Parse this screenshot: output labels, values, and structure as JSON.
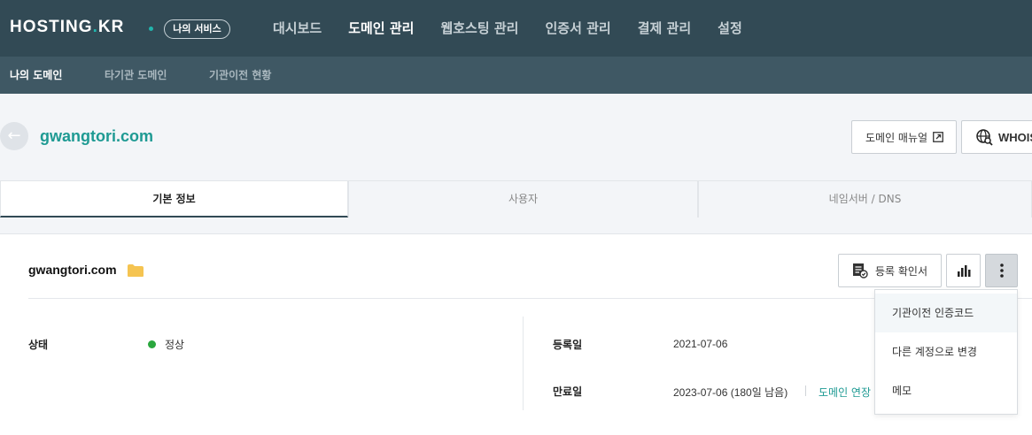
{
  "topbar": {
    "logo_main": "HOSTING",
    "logo_dot": ".",
    "logo_tld": "KR",
    "my_service": "나의 서비스",
    "nav": [
      {
        "label": "대시보드",
        "active": false
      },
      {
        "label": "도메인 관리",
        "active": true
      },
      {
        "label": "웹호스팅 관리",
        "active": false
      },
      {
        "label": "인증서 관리",
        "active": false
      },
      {
        "label": "결제 관리",
        "active": false
      },
      {
        "label": "설정",
        "active": false
      }
    ]
  },
  "subnav": {
    "items": [
      {
        "label": "나의 도메인",
        "active": true
      },
      {
        "label": "타기관 도메인",
        "active": false
      },
      {
        "label": "기관이전 현황",
        "active": false
      }
    ]
  },
  "header": {
    "domain": "gwangtori.com",
    "manual_button": "도메인 매뉴얼",
    "whois_button": "WHOIS"
  },
  "tabs": [
    {
      "label": "기본 정보",
      "active": true
    },
    {
      "label": "사용자",
      "active": false
    },
    {
      "label": "네임서버 / DNS",
      "active": false
    }
  ],
  "card": {
    "title": "gwangtori.com",
    "cert_button": "등록 확인서",
    "status_label": "상태",
    "status_value": "정상",
    "status_color": "#2aa73e",
    "registered_label": "등록일",
    "registered_value": "2021-07-06",
    "expiry_label": "만료일",
    "expiry_value": "2023-07-06 (180일 남음)",
    "renew_link": "도메인 연장"
  },
  "dropdown": {
    "items": [
      {
        "label": "기관이전 인증코드"
      },
      {
        "label": "다른 계정으로 변경"
      },
      {
        "label": "메모"
      }
    ]
  },
  "colors": {
    "topbar": "#324a55",
    "subbar": "#3f5864",
    "accent": "#1e9a93"
  }
}
